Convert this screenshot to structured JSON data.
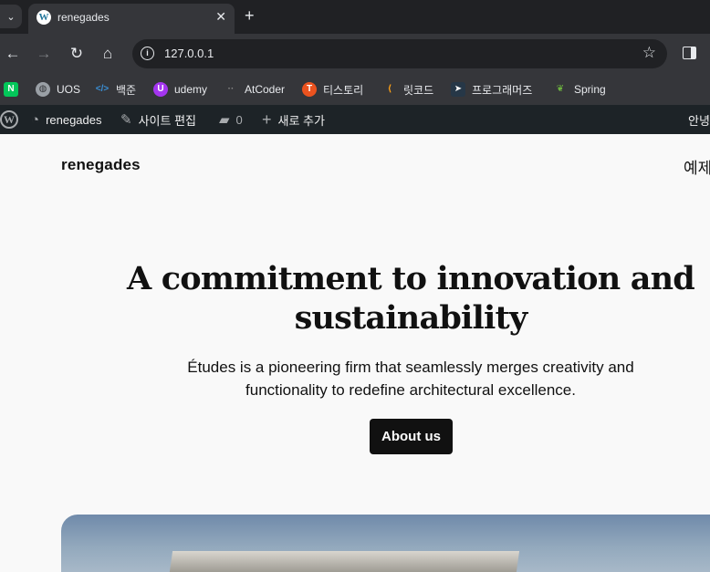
{
  "browser": {
    "tab_title": "renegades",
    "url": "127.0.0.1"
  },
  "bookmarks": [
    {
      "label": "",
      "icon": "naver-icon",
      "color": "#03c75a"
    },
    {
      "label": "UOS",
      "icon": "globe-icon",
      "color": "#9aa0a6"
    },
    {
      "label": "백준",
      "icon": "baekjoon-icon",
      "color": "#0076c0"
    },
    {
      "label": "udemy",
      "icon": "udemy-icon",
      "color": "#a435f0"
    },
    {
      "label": "AtCoder",
      "icon": "atcoder-icon",
      "color": "#555555"
    },
    {
      "label": "티스토리",
      "icon": "tistory-icon",
      "color": "#eb531f"
    },
    {
      "label": "릿코드",
      "icon": "leetcode-icon",
      "color": "#ffa116"
    },
    {
      "label": "프로그래머즈",
      "icon": "programmers-icon",
      "color": "#263747"
    },
    {
      "label": "Spring",
      "icon": "spring-icon",
      "color": "#6db33f"
    }
  ],
  "adminbar": {
    "site_name": "renegades",
    "edit_site": "사이트 편집",
    "comments_count": "0",
    "new_content": "새로 추가",
    "greeting": "안녕"
  },
  "site": {
    "title": "renegades",
    "nav_item": "예제"
  },
  "hero": {
    "heading": "A commitment to innovation and sustainability",
    "lead": "Études is a pioneering firm that seamlessly merges creativity and functionality to redefine architectural excellence.",
    "button_label": "About us"
  }
}
